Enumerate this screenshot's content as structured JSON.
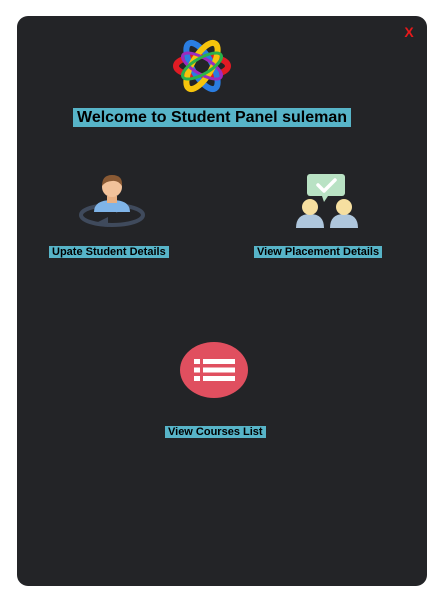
{
  "close": {
    "label": "X"
  },
  "header": {
    "welcome": "Welcome to Student Panel suleman"
  },
  "actions": [
    {
      "label": "Upate Student Details",
      "icon": "user-sync-icon"
    },
    {
      "label": "View Placement Details",
      "icon": "placement-chat-icon"
    },
    {
      "label": "View Courses List",
      "icon": "list-icon"
    }
  ],
  "colors": {
    "panel": "#232427",
    "label_bg": "#57b4c8",
    "close": "#e8191b",
    "list_icon": "#e04f5f"
  }
}
